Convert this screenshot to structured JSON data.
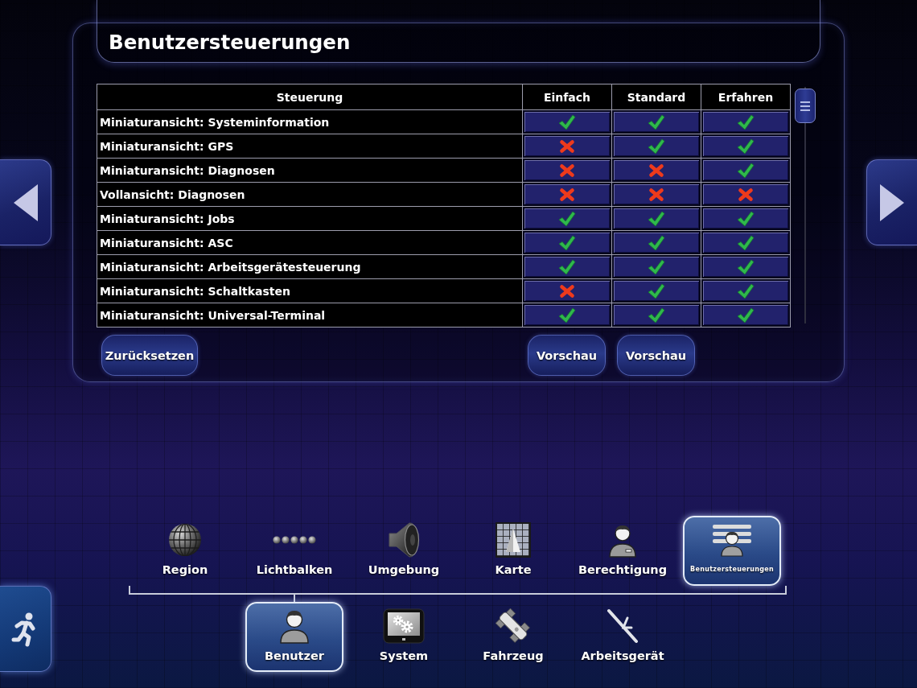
{
  "header": {
    "title": "Benutzersteuerungen"
  },
  "table": {
    "columns": [
      "Steuerung",
      "Einfach",
      "Standard",
      "Erfahren"
    ],
    "rows": [
      {
        "label": "Miniaturansicht: Systeminformation",
        "cells": [
          {
            "allowed": true
          },
          {
            "allowed": true
          },
          {
            "allowed": true
          }
        ]
      },
      {
        "label": "Miniaturansicht: GPS",
        "cells": [
          {
            "allowed": false
          },
          {
            "allowed": true
          },
          {
            "allowed": true
          }
        ]
      },
      {
        "label": "Miniaturansicht: Diagnosen",
        "cells": [
          {
            "allowed": false
          },
          {
            "allowed": false
          },
          {
            "allowed": true
          }
        ]
      },
      {
        "label": "Vollansicht: Diagnosen",
        "cells": [
          {
            "allowed": false
          },
          {
            "allowed": false
          },
          {
            "allowed": false
          }
        ]
      },
      {
        "label": "Miniaturansicht: Jobs",
        "cells": [
          {
            "allowed": true
          },
          {
            "allowed": true
          },
          {
            "allowed": true
          }
        ]
      },
      {
        "label": "Miniaturansicht: ASC",
        "cells": [
          {
            "allowed": true
          },
          {
            "allowed": true
          },
          {
            "allowed": true
          }
        ]
      },
      {
        "label": "Miniaturansicht: Arbeitsgerätesteuerung",
        "cells": [
          {
            "allowed": true
          },
          {
            "allowed": true
          },
          {
            "allowed": true
          }
        ]
      },
      {
        "label": "Miniaturansicht: Schaltkasten",
        "cells": [
          {
            "allowed": false
          },
          {
            "allowed": true
          },
          {
            "allowed": true
          }
        ]
      },
      {
        "label": "Miniaturansicht: Universal-Terminal",
        "cells": [
          {
            "allowed": true
          },
          {
            "allowed": true
          },
          {
            "allowed": true
          }
        ]
      }
    ]
  },
  "reset_button": "Zurücksetzen",
  "preview_buttons": [
    "Vorschau",
    "Vorschau"
  ],
  "sub_nav": [
    {
      "label": "Region",
      "selected": false
    },
    {
      "label": "Lichtbalken",
      "selected": false
    },
    {
      "label": "Umgebung",
      "selected": false
    },
    {
      "label": "Karte",
      "selected": false
    },
    {
      "label": "Berechtigung",
      "selected": false
    },
    {
      "label": "Benutzersteuerungen",
      "selected": true
    }
  ],
  "main_nav": [
    {
      "label": "Benutzer",
      "selected": true
    },
    {
      "label": "System",
      "selected": false
    },
    {
      "label": "Fahrzeug",
      "selected": false
    },
    {
      "label": "Arbeitsgerät",
      "selected": false
    }
  ]
}
